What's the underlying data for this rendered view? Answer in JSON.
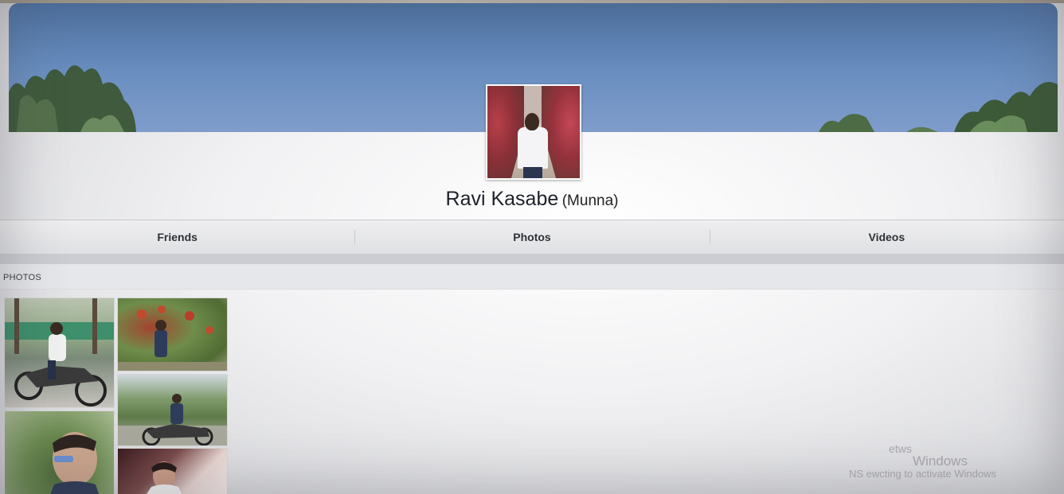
{
  "profile": {
    "name": "Ravi Kasabe",
    "nickname": "(Munna)"
  },
  "tabs": [
    {
      "label": "Friends"
    },
    {
      "label": "Photos"
    },
    {
      "label": "Videos"
    }
  ],
  "photos_section": {
    "title": "PHOTOS",
    "count": 5
  },
  "watermark": {
    "line1": "etws",
    "line2": "Windows",
    "line3": "NS ewcting to activate Windows"
  }
}
